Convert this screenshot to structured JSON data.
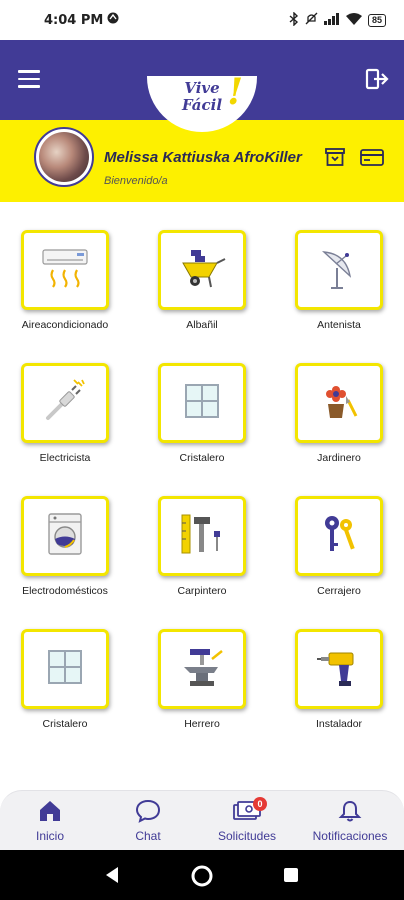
{
  "status_bar": {
    "time": "4:04 PM",
    "battery": "85"
  },
  "app": {
    "logo_line1": "Vive",
    "logo_line2": "Fácil",
    "logo_mark": "!"
  },
  "header": {
    "menu_icon": "hamburger-icon",
    "logout_icon": "logout-icon",
    "user_name": "Melissa Kattiuska AfroKiller",
    "welcome": "Bienvenido/a",
    "actions": [
      "archive-icon",
      "card-icon"
    ]
  },
  "services": [
    {
      "label": "Aireacondicionado",
      "icon": "air-conditioner-icon"
    },
    {
      "label": "Albañil",
      "icon": "wheelbarrow-icon"
    },
    {
      "label": "Antenista",
      "icon": "satellite-dish-icon"
    },
    {
      "label": "Electricista",
      "icon": "cable-plug-icon"
    },
    {
      "label": "Cristalero",
      "icon": "window-icon"
    },
    {
      "label": "Jardinero",
      "icon": "flower-pot-icon"
    },
    {
      "label": "Electrodomésticos",
      "icon": "washing-machine-icon"
    },
    {
      "label": "Carpintero",
      "icon": "carpentry-tools-icon"
    },
    {
      "label": "Cerrajero",
      "icon": "keys-icon"
    },
    {
      "label": "Cristalero",
      "icon": "window-icon"
    },
    {
      "label": "Herrero",
      "icon": "anvil-icon"
    },
    {
      "label": "Instalador",
      "icon": "drill-icon"
    }
  ],
  "bottom_nav": {
    "items": [
      {
        "label": "Inicio",
        "icon": "home-icon"
      },
      {
        "label": "Chat",
        "icon": "chat-bubble-icon"
      },
      {
        "label": "Solicitudes",
        "icon": "money-icon",
        "badge": "0"
      },
      {
        "label": "Notificaciones",
        "icon": "bell-icon"
      }
    ]
  },
  "colors": {
    "primary": "#413b96",
    "accent": "#fdf000",
    "badge": "#e53935"
  }
}
